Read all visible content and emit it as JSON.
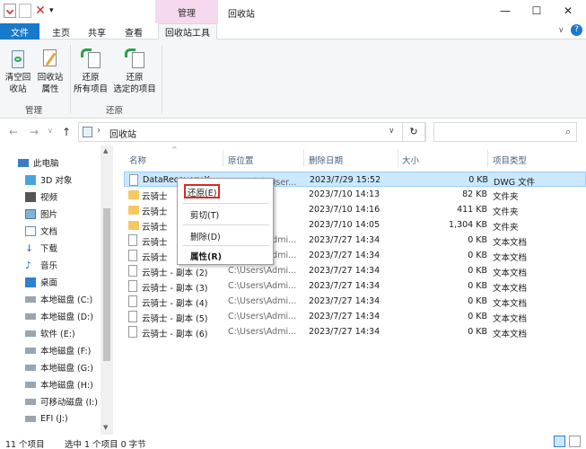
{
  "window": {
    "title": "回收站",
    "context_tab": "管理",
    "controls": [
      "—",
      "☐",
      "✕"
    ]
  },
  "tabs": {
    "file": "文件",
    "home": "主页",
    "share": "共享",
    "view": "查看",
    "recycle_tools": "回收站工具"
  },
  "ribbon": {
    "empty_bin": "清空回\n收站",
    "empty_bin_l1": "清空回",
    "empty_bin_l2": "收站",
    "props_l1": "回收站",
    "props_l2": "属性",
    "restore_all_l1": "还原",
    "restore_all_l2": "所有项目",
    "restore_sel_l1": "还原",
    "restore_sel_l2": "选定的项目",
    "group_manage": "管理",
    "group_restore": "还原"
  },
  "address": {
    "path": "回收站",
    "search_placeholder": ""
  },
  "nav": {
    "items": [
      {
        "label": "此电脑"
      },
      {
        "label": "3D 对象"
      },
      {
        "label": "视频"
      },
      {
        "label": "图片"
      },
      {
        "label": "文档"
      },
      {
        "label": "下载"
      },
      {
        "label": "音乐"
      },
      {
        "label": "桌面"
      },
      {
        "label": "本地磁盘 (C:)"
      },
      {
        "label": "本地磁盘 (D:)"
      },
      {
        "label": "软件 (E:)"
      },
      {
        "label": "本地磁盘 (F:)"
      },
      {
        "label": "本地磁盘 (G:)"
      },
      {
        "label": "本地磁盘 (H:)"
      },
      {
        "label": "可移动磁盘 (I:)"
      },
      {
        "label": "EFI (J:)"
      }
    ]
  },
  "columns": {
    "name": "名称",
    "location": "原位置",
    "deleted": "删除日期",
    "size": "大小",
    "type": "项目类型"
  },
  "files": [
    {
      "name": "DataRecovery.X",
      "location": "D:\\云骑士\\User...",
      "deleted": "2023/7/29 15:52",
      "size": "0 KB",
      "type": "DWG 文件",
      "icon": "doc"
    },
    {
      "name": "云骑士",
      "location": "",
      "deleted": "2023/7/10 14:13",
      "size": "82 KB",
      "type": "文件夹",
      "icon": "folder"
    },
    {
      "name": "云骑士",
      "location": "",
      "deleted": "2023/7/10 14:16",
      "size": "411 KB",
      "type": "文件夹",
      "icon": "folder"
    },
    {
      "name": "云骑士",
      "location": "",
      "deleted": "2023/7/10 14:05",
      "size": "1,304 KB",
      "type": "文件夹",
      "icon": "folder"
    },
    {
      "name": "云骑士",
      "location": "C:\\Users\\Admi...",
      "deleted": "2023/7/27 14:34",
      "size": "0 KB",
      "type": "文本文档",
      "icon": "doc"
    },
    {
      "name": "云骑士",
      "location": "C:\\Users\\Admi...",
      "deleted": "2023/7/27 14:34",
      "size": "0 KB",
      "type": "文本文档",
      "icon": "doc"
    },
    {
      "name": "云骑士 - 副本 (2)",
      "location": "C:\\Users\\Admi...",
      "deleted": "2023/7/27 14:34",
      "size": "0 KB",
      "type": "文本文档",
      "icon": "doc"
    },
    {
      "name": "云骑士 - 副本 (3)",
      "location": "C:\\Users\\Admi...",
      "deleted": "2023/7/27 14:34",
      "size": "0 KB",
      "type": "文本文档",
      "icon": "doc"
    },
    {
      "name": "云骑士 - 副本 (4)",
      "location": "C:\\Users\\Admi...",
      "deleted": "2023/7/27 14:34",
      "size": "0 KB",
      "type": "文本文档",
      "icon": "doc"
    },
    {
      "name": "云骑士 - 副本 (5)",
      "location": "C:\\Users\\Admi...",
      "deleted": "2023/7/27 14:34",
      "size": "0 KB",
      "type": "文本文档",
      "icon": "doc"
    },
    {
      "name": "云骑士 - 副本 (6)",
      "location": "C:\\Users\\Admi...",
      "deleted": "2023/7/27 14:34",
      "size": "0 KB",
      "type": "文本文档",
      "icon": "doc"
    }
  ],
  "context_menu": {
    "restore": "还原(E)",
    "cut": "剪切(T)",
    "delete": "删除(D)",
    "properties": "属性(R)"
  },
  "status": {
    "count": "11 个项目",
    "selection": "选中 1 个项目  0 字节"
  },
  "colors": {
    "accent": "#1979ca",
    "context_tab": "#f6d9ee",
    "selection": "#cce8ff",
    "highlight_box": "#d8292a"
  }
}
